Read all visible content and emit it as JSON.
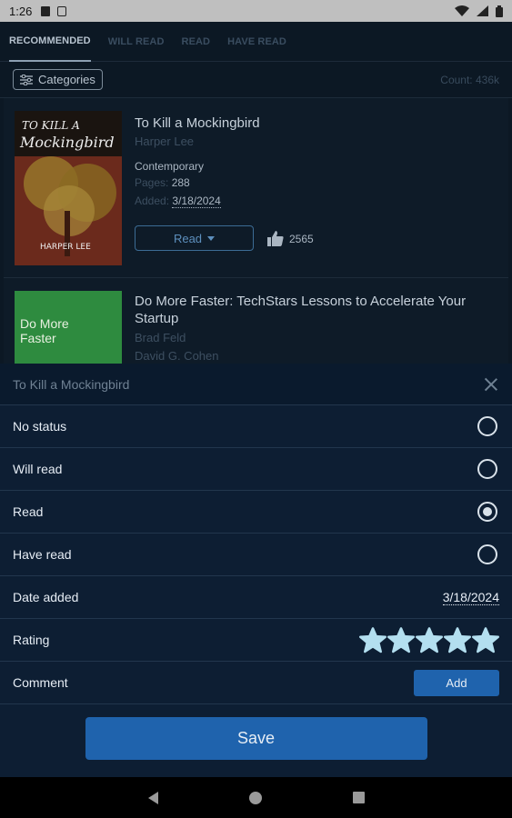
{
  "status_bar": {
    "time": "1:26"
  },
  "tabs": [
    {
      "label": "RECOMMENDED",
      "active": true
    },
    {
      "label": "WILL READ",
      "active": false
    },
    {
      "label": "READ",
      "active": false
    },
    {
      "label": "HAVE READ",
      "active": false
    }
  ],
  "filter": {
    "categories_label": "Categories",
    "count": "Count: 436k"
  },
  "books": [
    {
      "title": "To Kill a Mockingbird",
      "author": "Harper Lee",
      "genre": "Contemporary",
      "pages_label": "Pages:",
      "pages": "288",
      "added_label": "Added:",
      "added": "3/18/2024",
      "status_button": "Read",
      "likes": "2565",
      "cover_lines": [
        "TO KILL A",
        "Mockingbird",
        "HARPER LEE"
      ]
    },
    {
      "title": "Do More Faster: TechStars Lessons to Accelerate Your Startup",
      "authors": [
        "Brad Feld",
        "David G. Cohen"
      ],
      "cover_lines": [
        "Do More",
        "Faster"
      ]
    }
  ],
  "sheet": {
    "title": "To Kill a Mockingbird",
    "options": [
      {
        "label": "No status",
        "selected": false
      },
      {
        "label": "Will read",
        "selected": false
      },
      {
        "label": "Read",
        "selected": true
      },
      {
        "label": "Have read",
        "selected": false
      }
    ],
    "date_added_label": "Date added",
    "date_added": "3/18/2024",
    "rating_label": "Rating",
    "rating": 5,
    "comment_label": "Comment",
    "add_label": "Add",
    "save_label": "Save"
  },
  "colors": {
    "accent": "#1f63ad",
    "sheet_bg": "#0d1e33",
    "star": "#b3dff0"
  }
}
